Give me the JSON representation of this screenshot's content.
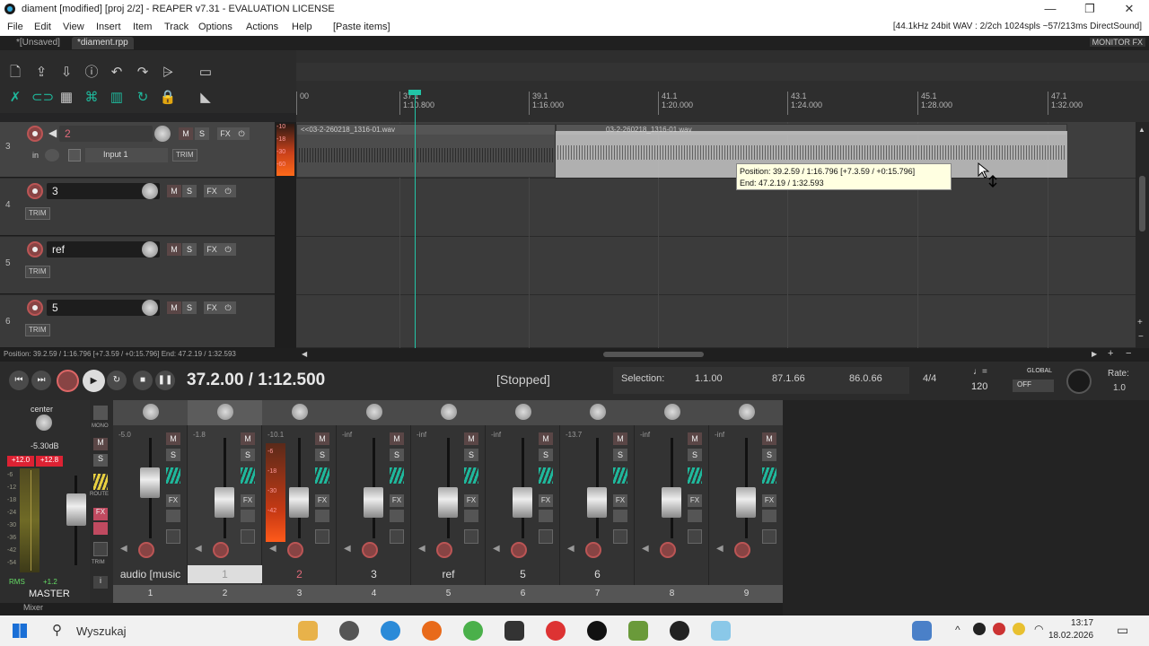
{
  "window": {
    "title": "diament [modified] [proj 2/2] - REAPER v7.31 - EVALUATION LICENSE",
    "controls": [
      "—",
      "❐",
      "✕"
    ]
  },
  "menu": {
    "items": [
      "File",
      "Edit",
      "View",
      "Insert",
      "Item",
      "Track",
      "Options",
      "Actions",
      "Help",
      "[Paste items]"
    ],
    "status": "[44.1kHz 24bit WAV : 2/2ch 1024spls ~57/213ms DirectSound]"
  },
  "project_tabs": [
    "*[Unsaved]",
    "*diament.rpp"
  ],
  "monitor_fx": "MONITOR FX",
  "ruler": {
    "marks": [
      {
        "bar": "00",
        "time": ""
      },
      {
        "bar": "37.1",
        "time": "1:10.800"
      },
      {
        "bar": "39.1",
        "time": "1:16.000"
      },
      {
        "bar": "41.1",
        "time": "1:20.000"
      },
      {
        "bar": "43.1",
        "time": "1:24.000"
      },
      {
        "bar": "45.1",
        "time": "1:28.000"
      },
      {
        "bar": "47.1",
        "time": "1:32.000"
      }
    ]
  },
  "tracks": [
    {
      "num": "3",
      "name": "2",
      "selected": true,
      "input": "in",
      "input_name": "Input 1",
      "trim": "TRIM"
    },
    {
      "num": "4",
      "name": "3",
      "selected": false,
      "trim": "TRIM"
    },
    {
      "num": "5",
      "name": "ref",
      "selected": false,
      "trim": "TRIM"
    },
    {
      "num": "6",
      "name": "5",
      "selected": false,
      "trim": "TRIM"
    }
  ],
  "track_buttons": {
    "mute": "M",
    "solo": "S",
    "fx": "FX"
  },
  "meter_strip_labels": [
    "-10",
    "-18",
    "-30",
    "-60"
  ],
  "items": [
    {
      "label": "<<03-2-260218_1316-01.wav"
    },
    {
      "label": "03-2-260218_1316-01.wav"
    }
  ],
  "tooltip": {
    "line1": "Position: 39.2.59 / 1:16.796 [+7.3.59 / +0:15.796]",
    "line2": "End: 47.2.19 / 1:32.593"
  },
  "statusbar": "Position: 39.2.59 / 1:16.796 [+7.3.59 / +0:15.796] End: 47.2.19 / 1:32.593",
  "transport": {
    "position": "37.2.00 / 1:12.500",
    "state": "[Stopped]",
    "selection_label": "Selection:",
    "sel_start": "1.1.00",
    "sel_end": "87.1.66",
    "sel_len": "86.0.66",
    "timesig": "4/4",
    "bpm": "120",
    "global": "GLOBAL",
    "global_state": "OFF",
    "rate_label": "Rate:",
    "rate": "1.0"
  },
  "master": {
    "pan": "center",
    "level": "-5.30dB",
    "peak_l": "+12.0",
    "peak_r": "+12.8",
    "scale": [
      "-6",
      "-12",
      "-18",
      "-24",
      "-30",
      "-36",
      "-42",
      "-54"
    ],
    "rms": "RMS",
    "rms_val": "+1.2",
    "label": "MASTER",
    "mono": "MONO",
    "mute": "M",
    "solo": "S",
    "route": "ROUTE",
    "fx": "FX",
    "trim": "TRIM",
    "info": "i"
  },
  "mixer_strips": [
    {
      "name": "audio [music",
      "num": "1",
      "db": "-5.0",
      "fader_pos": 0.58,
      "sel": false
    },
    {
      "name": "1",
      "num": "2",
      "db": "-1.8",
      "fader_pos": 0.3,
      "sel": true
    },
    {
      "name": "2",
      "num": "3",
      "db": "-10.1",
      "fader_pos": 0.3,
      "sel": false,
      "rec": true
    },
    {
      "name": "3",
      "num": "4",
      "db": "-inf",
      "fader_pos": 0.3,
      "sel": false
    },
    {
      "name": "ref",
      "num": "5",
      "db": "-inf",
      "fader_pos": 0.3,
      "sel": false
    },
    {
      "name": "5",
      "num": "6",
      "db": "-inf",
      "fader_pos": 0.3,
      "sel": false
    },
    {
      "name": "6",
      "num": "7",
      "db": "-13.7",
      "fader_pos": 0.3,
      "sel": false
    },
    {
      "name": "",
      "num": "8",
      "db": "-inf",
      "fader_pos": 0.3,
      "sel": false
    },
    {
      "name": "",
      "num": "9",
      "db": "-inf",
      "fader_pos": 0.3,
      "sel": false
    }
  ],
  "strip_buttons": {
    "mute": "M",
    "solo": "S",
    "fx": "FX"
  },
  "redmeter_labels": [
    "-6",
    "-18",
    "-30",
    "-42"
  ],
  "mixer_tab": "Mixer",
  "taskbar": {
    "search": "Wyszukaj",
    "time": "13:17",
    "date": "18.02.2026"
  },
  "colors": {
    "accent": "#1fb89c",
    "record": "#e06a7a",
    "selection": "#dcdcdc",
    "meter_peak": "#ff5a1a"
  }
}
